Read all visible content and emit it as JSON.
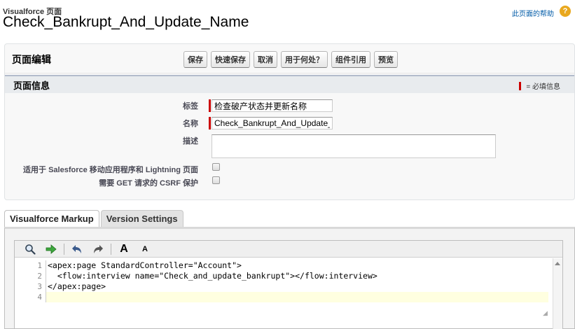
{
  "header": {
    "breadcrumb": "Visualforce 页面",
    "title": "Check_Bankrupt_And_Update_Name",
    "help_link": "此页面的帮助",
    "help_icon": "?"
  },
  "page_edit": {
    "title": "页面编辑",
    "buttons": [
      "保存",
      "快速保存",
      "取消",
      "用于何处？",
      "组件引用",
      "预览"
    ]
  },
  "page_info": {
    "section_title": "页面信息",
    "required_legend": "= 必填信息",
    "fields": {
      "label": {
        "label": "标签",
        "value": "检查破产状态并更新名称"
      },
      "name": {
        "label": "名称",
        "value": "Check_Bankrupt_And_Update_Name"
      },
      "description": {
        "label": "描述",
        "value": ""
      },
      "mobile_ready": {
        "label": "适用于 Salesforce 移动应用程序和 Lightning 页面",
        "checked": false
      },
      "csrf": {
        "label": "需要 GET 请求的 CSRF 保护",
        "checked": false
      }
    }
  },
  "tabs": [
    {
      "label": "Visualforce Markup",
      "active": true
    },
    {
      "label": "Version Settings",
      "active": false
    }
  ],
  "editor": {
    "toolbar": {
      "search_icon": "magnifier-icon",
      "goto_icon": "arrow-right-icon",
      "undo_icon": "undo-icon",
      "redo_icon": "redo-icon",
      "font_larger": "A",
      "font_smaller": "A"
    },
    "line_numbers": [
      "1",
      "2",
      "3",
      "4"
    ],
    "lines": [
      "<apex:page StandardController=\"Account\">",
      "  <flow:interview name=\"Check_and_update_bankrupt\"></flow:interview>",
      "</apex:page>",
      ""
    ]
  },
  "colors": {
    "required": "#cc0000",
    "help_icon": "#e9a81e",
    "link": "#015ba7",
    "active_line": "#ffffe0"
  }
}
